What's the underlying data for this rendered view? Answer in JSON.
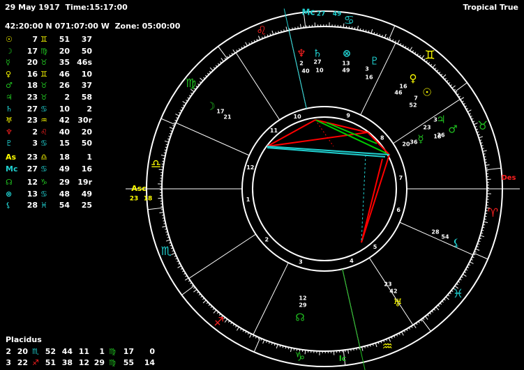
{
  "header": {
    "date_time": "29 May 1917  Time:15:17:00",
    "location": "42:20:00 N 071:07:00 W  Zone: 05:00:00",
    "mode": "Tropical True"
  },
  "colors": {
    "background": "#000000",
    "fire": "#ff2020",
    "earth": "#ffff00",
    "air": "#20c020",
    "water": "#20d0d0",
    "aspect_red": "#ff0000",
    "aspect_green": "#00cc00",
    "aspect_cyan": "#20d0d0",
    "text": "#ffffff"
  },
  "positions": [
    {
      "glyph": "☉",
      "glyph_color": "#ffff00",
      "deg": "7",
      "sign": "♊",
      "sign_color": "#ffff00",
      "min": "51",
      "sec": "37"
    },
    {
      "glyph": "☽",
      "glyph_color": "#20c020",
      "deg": "17",
      "sign": "♍",
      "sign_color": "#20c020",
      "min": "20",
      "sec": "50"
    },
    {
      "glyph": "☿",
      "glyph_color": "#20c020",
      "deg": "20",
      "sign": "♉",
      "sign_color": "#20c020",
      "min": "35",
      "sec": "46s"
    },
    {
      "glyph": "♀",
      "glyph_color": "#ffff00",
      "deg": "16",
      "sign": "♊",
      "sign_color": "#ffff00",
      "min": "46",
      "sec": "10"
    },
    {
      "glyph": "♂",
      "glyph_color": "#20c020",
      "deg": "18",
      "sign": "♉",
      "sign_color": "#20c020",
      "min": "26",
      "sec": "37"
    },
    {
      "glyph": "♃",
      "glyph_color": "#20c020",
      "deg": "23",
      "sign": "♉",
      "sign_color": "#20c020",
      "min": "2",
      "sec": "58"
    },
    {
      "glyph": "♄",
      "glyph_color": "#20d0d0",
      "deg": "27",
      "sign": "♋",
      "sign_color": "#20d0d0",
      "min": "10",
      "sec": "2"
    },
    {
      "glyph": "♅",
      "glyph_color": "#ffff00",
      "deg": "23",
      "sign": "♒",
      "sign_color": "#ffff00",
      "min": "42",
      "sec": "30r"
    },
    {
      "glyph": "♆",
      "glyph_color": "#ff2020",
      "deg": "2",
      "sign": "♌",
      "sign_color": "#ff2020",
      "min": "40",
      "sec": "20"
    },
    {
      "glyph": "♇",
      "glyph_color": "#20d0d0",
      "deg": "3",
      "sign": "♋",
      "sign_color": "#20d0d0",
      "min": "15",
      "sec": "50"
    },
    {
      "glyph": "As",
      "glyph_color": "#ffff00",
      "deg": "23",
      "sign": "♎",
      "sign_color": "#ffff00",
      "min": "18",
      "sec": "1"
    },
    {
      "glyph": "Mc",
      "glyph_color": "#20d0d0",
      "deg": "27",
      "sign": "♋",
      "sign_color": "#20d0d0",
      "min": "49",
      "sec": "16"
    },
    {
      "glyph": "☊",
      "glyph_color": "#20c020",
      "deg": "12",
      "sign": "♑",
      "sign_color": "#20c020",
      "min": "29",
      "sec": "19r"
    },
    {
      "glyph": "⊗",
      "glyph_color": "#20d0d0",
      "deg": "13",
      "sign": "♋",
      "sign_color": "#20d0d0",
      "min": "48",
      "sec": "49"
    },
    {
      "glyph": "⚸",
      "glyph_color": "#20d0d0",
      "deg": "28",
      "sign": "♓",
      "sign_color": "#20d0d0",
      "min": "54",
      "sec": "25"
    }
  ],
  "houses_title": "Placidus",
  "houses": [
    {
      "a": "2",
      "b": "20",
      "b_sign": "♏",
      "b_sign_color": "#20d0d0",
      "c": "52",
      "d": "44",
      "e": "11",
      "f": "1",
      "f_sign": "♍",
      "f_sign_color": "#20c020",
      "g": "17",
      "h": "0"
    },
    {
      "a": "3",
      "b": "22",
      "b_sign": "♐",
      "b_sign_color": "#ff2020",
      "c": "51",
      "d": "38",
      "e": "12",
      "f": "29",
      "f_sign": "♍",
      "f_sign_color": "#20c020",
      "g": "55",
      "h": "14"
    }
  ],
  "wheel": {
    "angle_labels": {
      "asc": "Asc",
      "mc": "Mc",
      "des": "Des",
      "ic": "Ic"
    },
    "asc_deg": "23",
    "asc_min": "18",
    "mc_deg": "27",
    "mc_min": "49",
    "house_numbers": [
      "1",
      "2",
      "3",
      "4",
      "5",
      "6",
      "7",
      "8",
      "9",
      "10",
      "11",
      "12"
    ],
    "zodiac": [
      {
        "glyph": "♌",
        "color": "#ff2020",
        "name": "leo"
      },
      {
        "glyph": "♋",
        "color": "#20d0d0",
        "name": "cancer"
      },
      {
        "glyph": "♊",
        "color": "#ffff00",
        "name": "gemini"
      },
      {
        "glyph": "♉",
        "color": "#20c020",
        "name": "taurus"
      },
      {
        "glyph": "♈",
        "color": "#ff2020",
        "name": "aries"
      },
      {
        "glyph": "♓",
        "color": "#20d0d0",
        "name": "pisces"
      },
      {
        "glyph": "♒",
        "color": "#ffff00",
        "name": "aquarius"
      },
      {
        "glyph": "♑",
        "color": "#20c020",
        "name": "capricorn"
      },
      {
        "glyph": "♐",
        "color": "#ff2020",
        "name": "sagittarius"
      },
      {
        "glyph": "♏",
        "color": "#20d0d0",
        "name": "scorpio"
      },
      {
        "glyph": "♎",
        "color": "#ffff00",
        "name": "libra"
      },
      {
        "glyph": "♍",
        "color": "#20c020",
        "name": "virgo"
      }
    ],
    "planets_in_wheel": [
      {
        "name": "neptune",
        "glyph": "♆",
        "color": "#ff2020",
        "deg": "2",
        "min": "40"
      },
      {
        "name": "saturn",
        "glyph": "♄",
        "color": "#20d0d0",
        "deg": "27",
        "min": "10"
      },
      {
        "name": "part-of-fortune",
        "glyph": "⊗",
        "color": "#20d0d0",
        "deg": "13",
        "min": "49"
      },
      {
        "name": "pluto",
        "glyph": "♇",
        "color": "#20d0d0",
        "deg": "3",
        "min": "16"
      },
      {
        "name": "venus",
        "glyph": "♀",
        "color": "#ffff00",
        "deg": "16",
        "min": "46"
      },
      {
        "name": "sun",
        "glyph": "☉",
        "color": "#ffff00",
        "deg": "7",
        "min": "52"
      },
      {
        "name": "jupiter",
        "glyph": "♃",
        "color": "#20c020",
        "deg": "23",
        "min": "3"
      },
      {
        "name": "mars",
        "glyph": "♂",
        "color": "#20c020",
        "deg": "18",
        "min": "26"
      },
      {
        "name": "mercury",
        "glyph": "☿",
        "color": "#20c020",
        "deg": "20",
        "min": "36"
      },
      {
        "name": "chiron",
        "glyph": "⚸",
        "color": "#20d0d0",
        "deg": "28",
        "min": "54"
      },
      {
        "name": "uranus",
        "glyph": "♅",
        "color": "#ffff00",
        "deg": "23",
        "min": "42"
      },
      {
        "name": "node",
        "glyph": "☊",
        "color": "#20c020",
        "deg": "12",
        "min": "29"
      },
      {
        "name": "moon",
        "glyph": "☽",
        "color": "#20c020",
        "deg": "17",
        "min": "21"
      }
    ]
  }
}
